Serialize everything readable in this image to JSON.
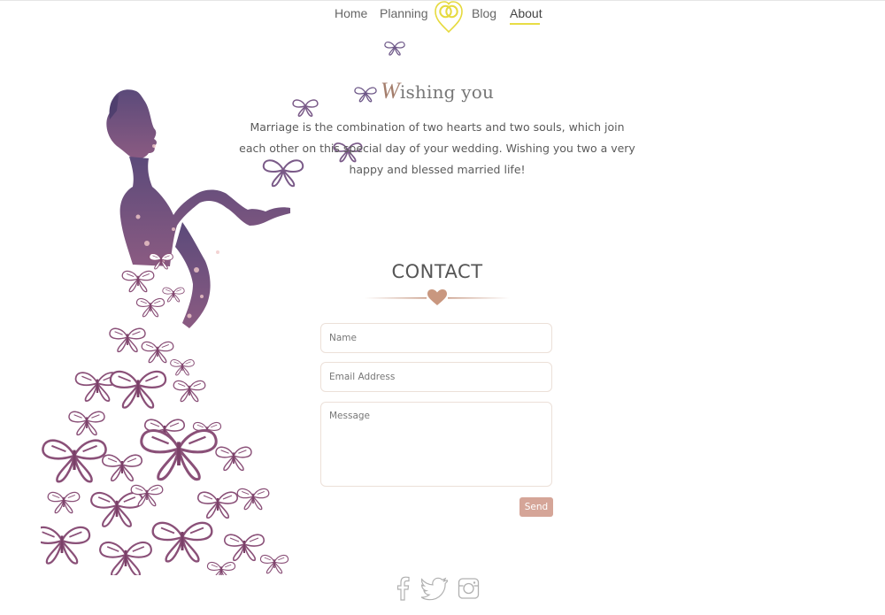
{
  "nav": {
    "items": [
      {
        "label": "Home"
      },
      {
        "label": "Planning"
      },
      {
        "label": "Blog"
      },
      {
        "label": "About"
      }
    ],
    "active": "About",
    "accent_color": "#e8dd45"
  },
  "hero": {
    "heading_initial": "W",
    "heading_rest": "ishing you",
    "text": "Marriage is the combination of two hearts and two souls, which join each other on this special day of your wedding. Wishing you two a very happy and blessed married life!"
  },
  "contact": {
    "title": "CONTACT",
    "name_placeholder": "Name",
    "email_placeholder": "Email Address",
    "message_placeholder": "Message",
    "send_label": "Send",
    "button_color": "#d5a598"
  },
  "footer": {
    "social": [
      "facebook-icon",
      "twitter-icon",
      "instagram-icon"
    ]
  }
}
